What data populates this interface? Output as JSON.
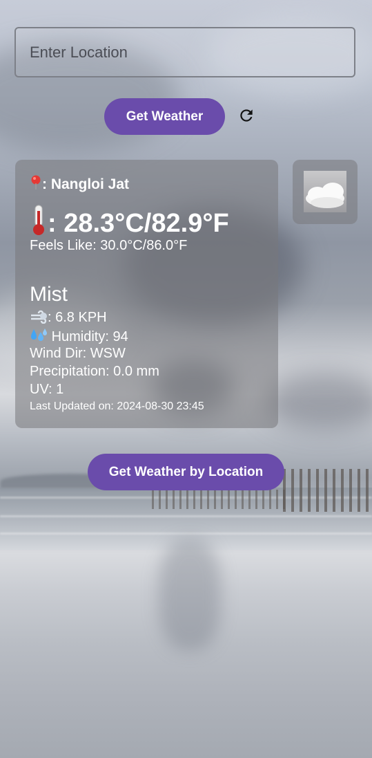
{
  "search": {
    "placeholder": "Enter Location"
  },
  "buttons": {
    "get_weather": "Get Weather",
    "get_weather_by_location": "Get Weather by Location"
  },
  "weather": {
    "location": ": Nangloi Jat",
    "temperature": ": 28.3°C/82.9°F",
    "feels_like": "Feels Like: 30.0°C/86.0°F",
    "condition": "Mist",
    "wind": ": 6.8 KPH",
    "humidity": "Humidity: 94",
    "wind_dir": "Wind Dir: WSW",
    "precipitation": "Precipitation: 0.0 mm",
    "uv": "UV: 1",
    "last_updated": "Last Updated on: 2024-08-30 23:45"
  },
  "icons": {
    "refresh": "refresh-icon",
    "location": "location-pin-icon",
    "thermometer": "thermometer-icon",
    "wind": "wind-icon",
    "humidity": "droplets-icon",
    "condition": "mist-cloud-icon"
  },
  "colors": {
    "accent": "#6a4cab",
    "card": "rgba(120,120,124,0.55)"
  }
}
